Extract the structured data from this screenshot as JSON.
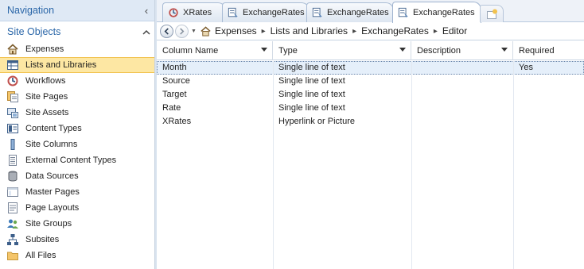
{
  "navigation": {
    "title": "Navigation",
    "collapse_glyph": "‹",
    "section_title": "Site Objects",
    "section_glyph": "^",
    "items": [
      {
        "label": "Expenses",
        "icon": "home-icon"
      },
      {
        "label": "Lists and Libraries",
        "icon": "list-icon",
        "selected": true
      },
      {
        "label": "Workflows",
        "icon": "workflow-icon"
      },
      {
        "label": "Site Pages",
        "icon": "pages-icon"
      },
      {
        "label": "Site Assets",
        "icon": "assets-icon"
      },
      {
        "label": "Content Types",
        "icon": "content-types-icon"
      },
      {
        "label": "Site Columns",
        "icon": "column-icon"
      },
      {
        "label": "External Content Types",
        "icon": "external-content-icon"
      },
      {
        "label": "Data Sources",
        "icon": "database-icon"
      },
      {
        "label": "Master Pages",
        "icon": "master-page-icon"
      },
      {
        "label": "Page Layouts",
        "icon": "page-layout-icon"
      },
      {
        "label": "Site Groups",
        "icon": "users-icon"
      },
      {
        "label": "Subsites",
        "icon": "subsites-icon"
      },
      {
        "label": "All Files",
        "icon": "folder-icon"
      }
    ]
  },
  "tabs": [
    {
      "label": "XRates",
      "icon": "workflow-icon"
    },
    {
      "label": "ExchangeRates",
      "icon": "list-form-icon"
    },
    {
      "label": "ExchangeRates",
      "icon": "list-form-icon"
    },
    {
      "label": "ExchangeRates",
      "icon": "list-form-icon",
      "active": true
    }
  ],
  "new_tab_icon": "new-tab-icon",
  "breadcrumb": {
    "items": [
      "Expenses",
      "Lists and Libraries",
      "ExchangeRates",
      "Editor"
    ],
    "separator": "▸"
  },
  "grid": {
    "columns": [
      "Column Name",
      "Type",
      "Description",
      "Required"
    ],
    "rows": [
      {
        "name": "Month",
        "type": "Single line of text",
        "description": "",
        "required": "Yes",
        "selected": true
      },
      {
        "name": "Source",
        "type": "Single line of text",
        "description": "",
        "required": ""
      },
      {
        "name": "Target",
        "type": "Single line of text",
        "description": "",
        "required": ""
      },
      {
        "name": "Rate",
        "type": "Single line of text",
        "description": "",
        "required": ""
      },
      {
        "name": "XRates",
        "type": "Hyperlink or Picture",
        "description": "",
        "required": ""
      }
    ]
  },
  "colors": {
    "accent": "#2a66a8",
    "selected_nav": "#fde7a3",
    "selected_row": "#e5effa"
  }
}
